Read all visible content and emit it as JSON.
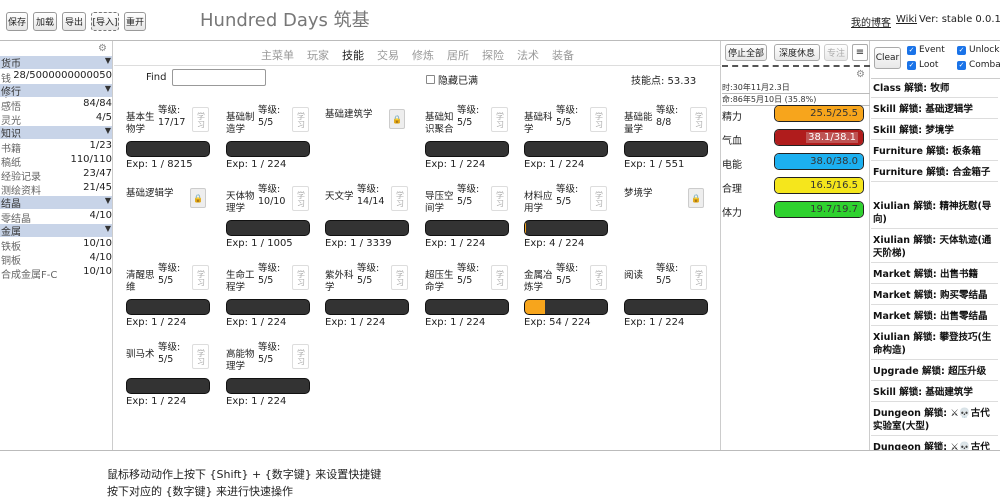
{
  "toolbar": {
    "save": "保存",
    "load": "加载",
    "export": "导出",
    "import": "[导入]",
    "restart": "重开"
  },
  "app_title": "Hundred Days 筑基",
  "header": {
    "blog_link": "我的博客",
    "wiki_link": "Wiki",
    "version": "Ver: stable 0.0.1"
  },
  "sidebar": {
    "categories": [
      {
        "name": "货币",
        "items": [
          {
            "label": "钱币",
            "value": "28/5000000000050"
          }
        ]
      },
      {
        "name": "修行",
        "items": [
          {
            "label": "感悟",
            "value": "84/84"
          },
          {
            "label": "灵光",
            "value": "4/5"
          }
        ]
      },
      {
        "name": "知识",
        "items": [
          {
            "label": "书籍",
            "value": "1/23"
          },
          {
            "label": "稿纸",
            "value": "110/110"
          },
          {
            "label": "经验记录",
            "value": "23/47"
          },
          {
            "label": "测绘资料",
            "value": "21/45"
          }
        ]
      },
      {
        "name": "结晶",
        "items": [
          {
            "label": "零结晶",
            "value": "4/10"
          }
        ]
      },
      {
        "name": "金属",
        "items": [
          {
            "label": "铁板",
            "value": "10/10"
          },
          {
            "label": "铜板",
            "value": "4/10"
          },
          {
            "label": "合成金属F-C",
            "value": "10/10"
          }
        ]
      }
    ]
  },
  "tabs": [
    "主菜单",
    "玩家",
    "技能",
    "交易",
    "修炼",
    "居所",
    "探险",
    "法术",
    "装备"
  ],
  "active_tab": "技能",
  "find": {
    "label": "Find",
    "value": ""
  },
  "hide_full_label": "隐藏已满",
  "skill_points": "技能点: 53.33",
  "learn_label": "学习",
  "skills": [
    {
      "name": "基本生物学",
      "level": "等级: 17/17",
      "exp": "Exp: 1 / 8215",
      "progress": 0,
      "locked": false
    },
    {
      "name": "基础制造学",
      "level": "等级: 5/5",
      "exp": "Exp: 1 / 224",
      "progress": 0,
      "locked": false
    },
    {
      "name": "基础建筑学",
      "level": "",
      "exp": "",
      "progress": 0,
      "locked": true
    },
    {
      "name": "基础知识聚合",
      "level": "等级: 5/5",
      "exp": "Exp: 1 / 224",
      "progress": 0,
      "locked": false
    },
    {
      "name": "基础科学",
      "level": "等级: 5/5",
      "exp": "Exp: 1 / 224",
      "progress": 0,
      "locked": false
    },
    {
      "name": "基础能量学",
      "level": "等级: 8/8",
      "exp": "Exp: 1 / 551",
      "progress": 0,
      "locked": false
    },
    {
      "name": "基础逻辑学",
      "level": "",
      "exp": "",
      "progress": 0,
      "locked": true
    },
    {
      "name": "天体物理学",
      "level": "等级: 10/10",
      "exp": "Exp: 1 / 1005",
      "progress": 0,
      "locked": false
    },
    {
      "name": "天文学",
      "level": "等级: 14/14",
      "exp": "Exp: 1 / 3339",
      "progress": 0,
      "locked": false
    },
    {
      "name": "导压空间学",
      "level": "等级: 5/5",
      "exp": "Exp: 1 / 224",
      "progress": 0,
      "locked": false
    },
    {
      "name": "材料应用学",
      "level": "等级: 5/5",
      "exp": "Exp: 4 / 224",
      "progress": 0.018,
      "locked": false
    },
    {
      "name": "梦境学",
      "level": "",
      "exp": "",
      "progress": 0,
      "locked": true
    },
    {
      "name": "清醒思维",
      "level": "等级: 5/5",
      "exp": "Exp: 1 / 224",
      "progress": 0,
      "locked": false
    },
    {
      "name": "生命工程学",
      "level": "等级: 5/5",
      "exp": "Exp: 1 / 224",
      "progress": 0,
      "locked": false
    },
    {
      "name": "紫外科学",
      "level": "等级: 5/5",
      "exp": "Exp: 1 / 224",
      "progress": 0,
      "locked": false
    },
    {
      "name": "超压生命学",
      "level": "等级: 5/5",
      "exp": "Exp: 1 / 224",
      "progress": 0,
      "locked": false
    },
    {
      "name": "金属冶炼学",
      "level": "等级: 5/5",
      "exp": "Exp: 54 / 224",
      "progress": 0.24,
      "locked": false
    },
    {
      "name": "阅读",
      "level": "等级: 5/5",
      "exp": "Exp: 1 / 224",
      "progress": 0,
      "locked": false
    },
    {
      "name": "驯马术",
      "level": "等级: 5/5",
      "exp": "Exp: 1 / 224",
      "progress": 0,
      "locked": false
    },
    {
      "name": "高能物理学",
      "level": "等级: 5/5",
      "exp": "Exp: 1 / 224",
      "progress": 0,
      "locked": false
    }
  ],
  "stats_panel": {
    "stop_all": "停止全部",
    "deep_rest": "深度休息",
    "focus": "专注",
    "time1": "时:30年11月2.3日",
    "time2": "命:86年5月10日 (35.8%)",
    "stats": [
      {
        "label": "精力",
        "value": "25.5/25.5",
        "fraction": 1.0,
        "color": "#f7a51c"
      },
      {
        "label": "气血",
        "value": "38.1/38.1",
        "fraction": 1.0,
        "color": "#b01c1c"
      },
      {
        "label": "电能",
        "value": "38.0/38.0",
        "fraction": 1.0,
        "color": "#1cb0f0"
      },
      {
        "label": "合理",
        "value": "16.5/16.5",
        "fraction": 1.0,
        "color": "#f5e61c"
      },
      {
        "label": "体力",
        "value": "19.7/19.7",
        "fraction": 1.0,
        "color": "#2fd22f"
      }
    ]
  },
  "log_panel": {
    "clear": "Clear",
    "filters": [
      {
        "label": "Event",
        "checked": true
      },
      {
        "label": "Unlock",
        "checked": true
      },
      {
        "label": "Loot",
        "checked": true
      },
      {
        "label": "Combat",
        "checked": true
      }
    ],
    "messages": [
      "Class 解锁: 牧师",
      "Skill 解锁: 基础逻辑学",
      "Skill 解锁: 梦境学",
      "Furniture 解锁: 板条箱",
      "Furniture 解锁: 合金箱子",
      "Xiulian 解锁: 精神抚慰(导向)",
      "Xiulian 解锁: 天体轨迹(通天阶梯)",
      "Market 解锁: 出售书籍",
      "Market 解锁: 购买零结晶",
      "Market 解锁: 出售零结晶",
      "Xiulian 解锁: 攀登技巧(生命构造)",
      "Upgrade 解锁: 超压升级",
      "Skill 解锁: 基础建筑学",
      "Dungeon 解锁: ⚔💀古代实验室(大型)",
      "Dungeon 解锁: ⚔💀古代实"
    ]
  },
  "hints": [
    "鼠标移动动作上按下 {Shift} + {数字键} 来设置快捷键",
    "按下对应的 {数字键} 来进行快速操作"
  ]
}
